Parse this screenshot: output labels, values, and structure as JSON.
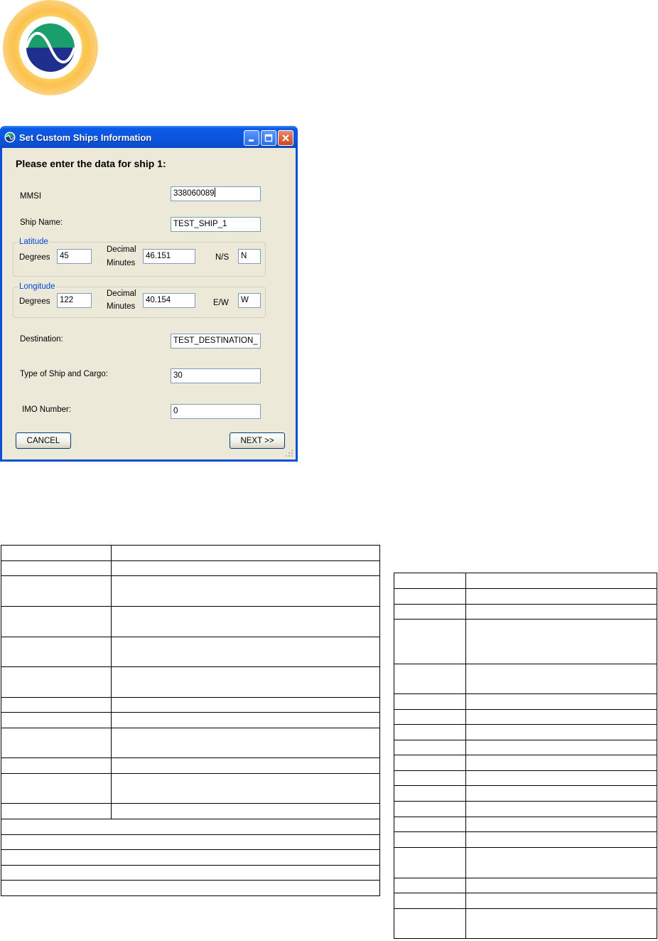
{
  "window": {
    "title": "Set Custom Ships Information",
    "heading": "Please enter the data for ship 1:"
  },
  "form": {
    "mmsi": {
      "label": "MMSI",
      "value": "338060089"
    },
    "ship_name": {
      "label": "Ship Name:",
      "value": "TEST_SHIP_1"
    },
    "latitude": {
      "legend": "Latitude",
      "degrees_label": "Degrees",
      "degrees_value": "45",
      "decimal_label": "Decimal",
      "minutes_label": "Minutes",
      "minutes_value": "46.151",
      "dir_label": "N/S",
      "dir_value": "N"
    },
    "longitude": {
      "legend": "Longitude",
      "degrees_label": "Degrees",
      "degrees_value": "122",
      "decimal_label": "Decimal",
      "minutes_label": "Minutes",
      "minutes_value": "40.154",
      "dir_label": "E/W",
      "dir_value": "W"
    },
    "destination": {
      "label": "Destination:",
      "value": "TEST_DESTINATION_"
    },
    "ship_type": {
      "label": "Type of Ship and Cargo:",
      "value": "30"
    },
    "imo": {
      "label": "IMO Number:",
      "value": "0"
    }
  },
  "buttons": {
    "cancel": "CANCEL",
    "next": "NEXT >>"
  },
  "colors": {
    "titlebar": "#0b56e0",
    "dialog_bg": "#ece9d8",
    "group_legend": "#0046d5",
    "logo_green": "#1a9e6b",
    "logo_blue": "#1f2f8e",
    "logo_glow": "#fbc14a"
  },
  "icons": [
    "logo-wave-icon",
    "app-icon",
    "minimize-icon",
    "maximize-icon",
    "close-icon",
    "resize-grip-icon"
  ]
}
